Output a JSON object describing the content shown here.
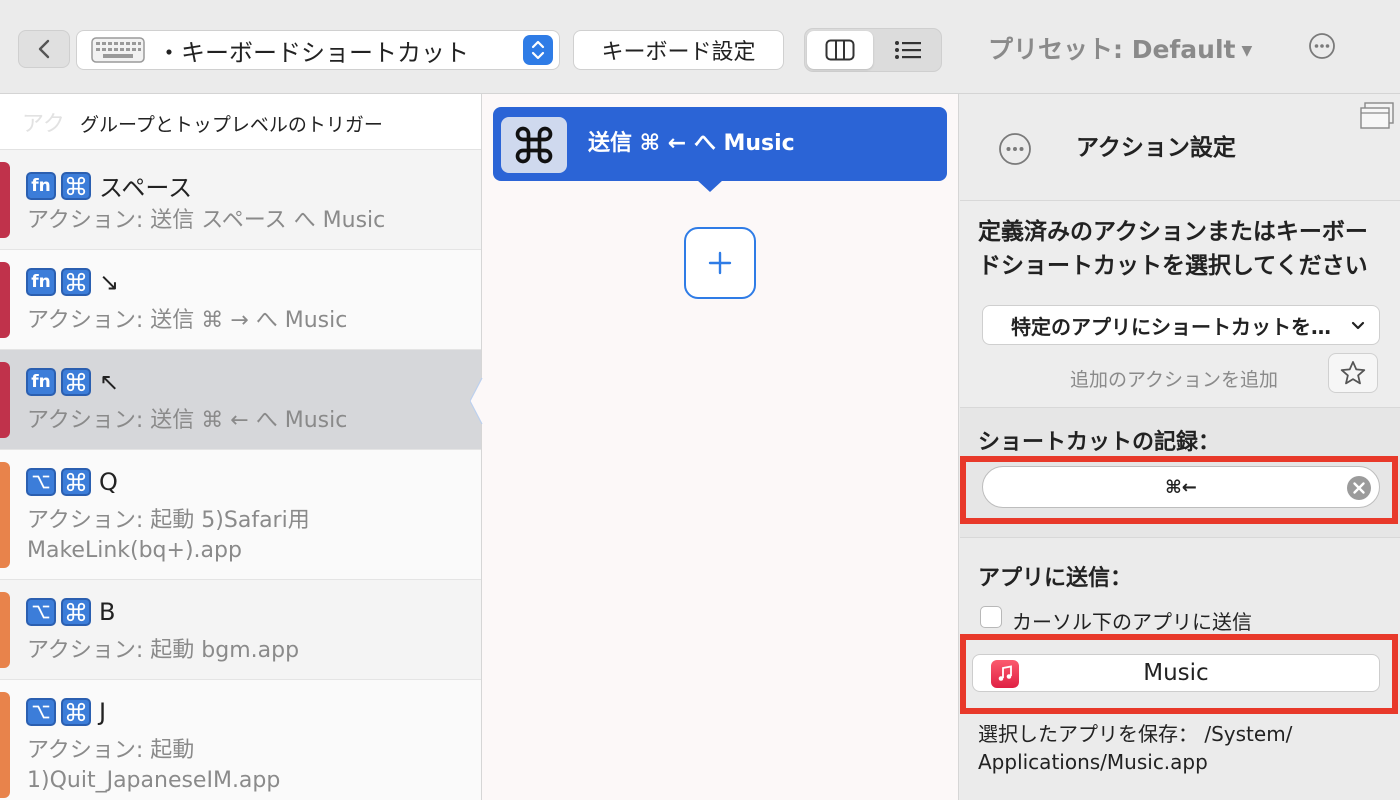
{
  "toolbar": {
    "trigger_type": "・キーボードショートカット",
    "keyboard_settings_label": "キーボード設定",
    "preset_label": "プリセット: Default"
  },
  "left_panel": {
    "header_ghost": "アク",
    "header_title": "グループとトップレベルのトリガー",
    "triggers": [
      {
        "keys": [
          "fn",
          "cmd"
        ],
        "key_name": "スペース",
        "description": "アクション: 送信  スペース へ Music",
        "stripe_color": "#c0324b",
        "selected": false
      },
      {
        "keys": [
          "fn",
          "cmd"
        ],
        "key_name": "↘",
        "description": "アクション: 送信 ⌘ → へ Music",
        "stripe_color": "#c0324b",
        "selected": false
      },
      {
        "keys": [
          "fn",
          "cmd"
        ],
        "key_name": "↖",
        "description": "アクション: 送信 ⌘ ← へ Music",
        "stripe_color": "#c0324b",
        "selected": true
      },
      {
        "keys": [
          "opt",
          "cmd"
        ],
        "key_name": "Q",
        "description": "アクション: 起動 5)Safari用 MakeLink(bq+).app",
        "stripe_color": "#e8834b",
        "selected": false
      },
      {
        "keys": [
          "opt",
          "cmd"
        ],
        "key_name": "B",
        "description": "アクション: 起動 bgm.app",
        "stripe_color": "#e8834b",
        "selected": false
      },
      {
        "keys": [
          "opt",
          "cmd"
        ],
        "key_name": "J",
        "description": "アクション: 起動 1)Quit_JapaneseIM.app",
        "stripe_color": "#e8834b",
        "selected": false
      }
    ]
  },
  "middle_panel": {
    "action_label": "送信 ⌘ ← へ Music",
    "add_label": "+"
  },
  "right_panel": {
    "title": "アクション設定",
    "prompt": "定義済みのアクションまたはキーボードショートカットを選択してください",
    "dropdown_value": "特定のアプリにショートカットを…",
    "add_action_label": "追加のアクションを追加",
    "shortcut_record_label": "ショートカットの記録：",
    "shortcut_value": "⌘←",
    "send_to_app_label": "アプリに送信：",
    "cursor_app_checkbox_label": "カーソル下のアプリに送信",
    "app_name": "Music",
    "saved_app_label": "選択したアプリを保存： /System/ Applications/Music.app"
  },
  "colors": {
    "accent_blue": "#2b64d6",
    "highlight_red": "#e8392a",
    "key_badge": "#3c7dd9"
  }
}
